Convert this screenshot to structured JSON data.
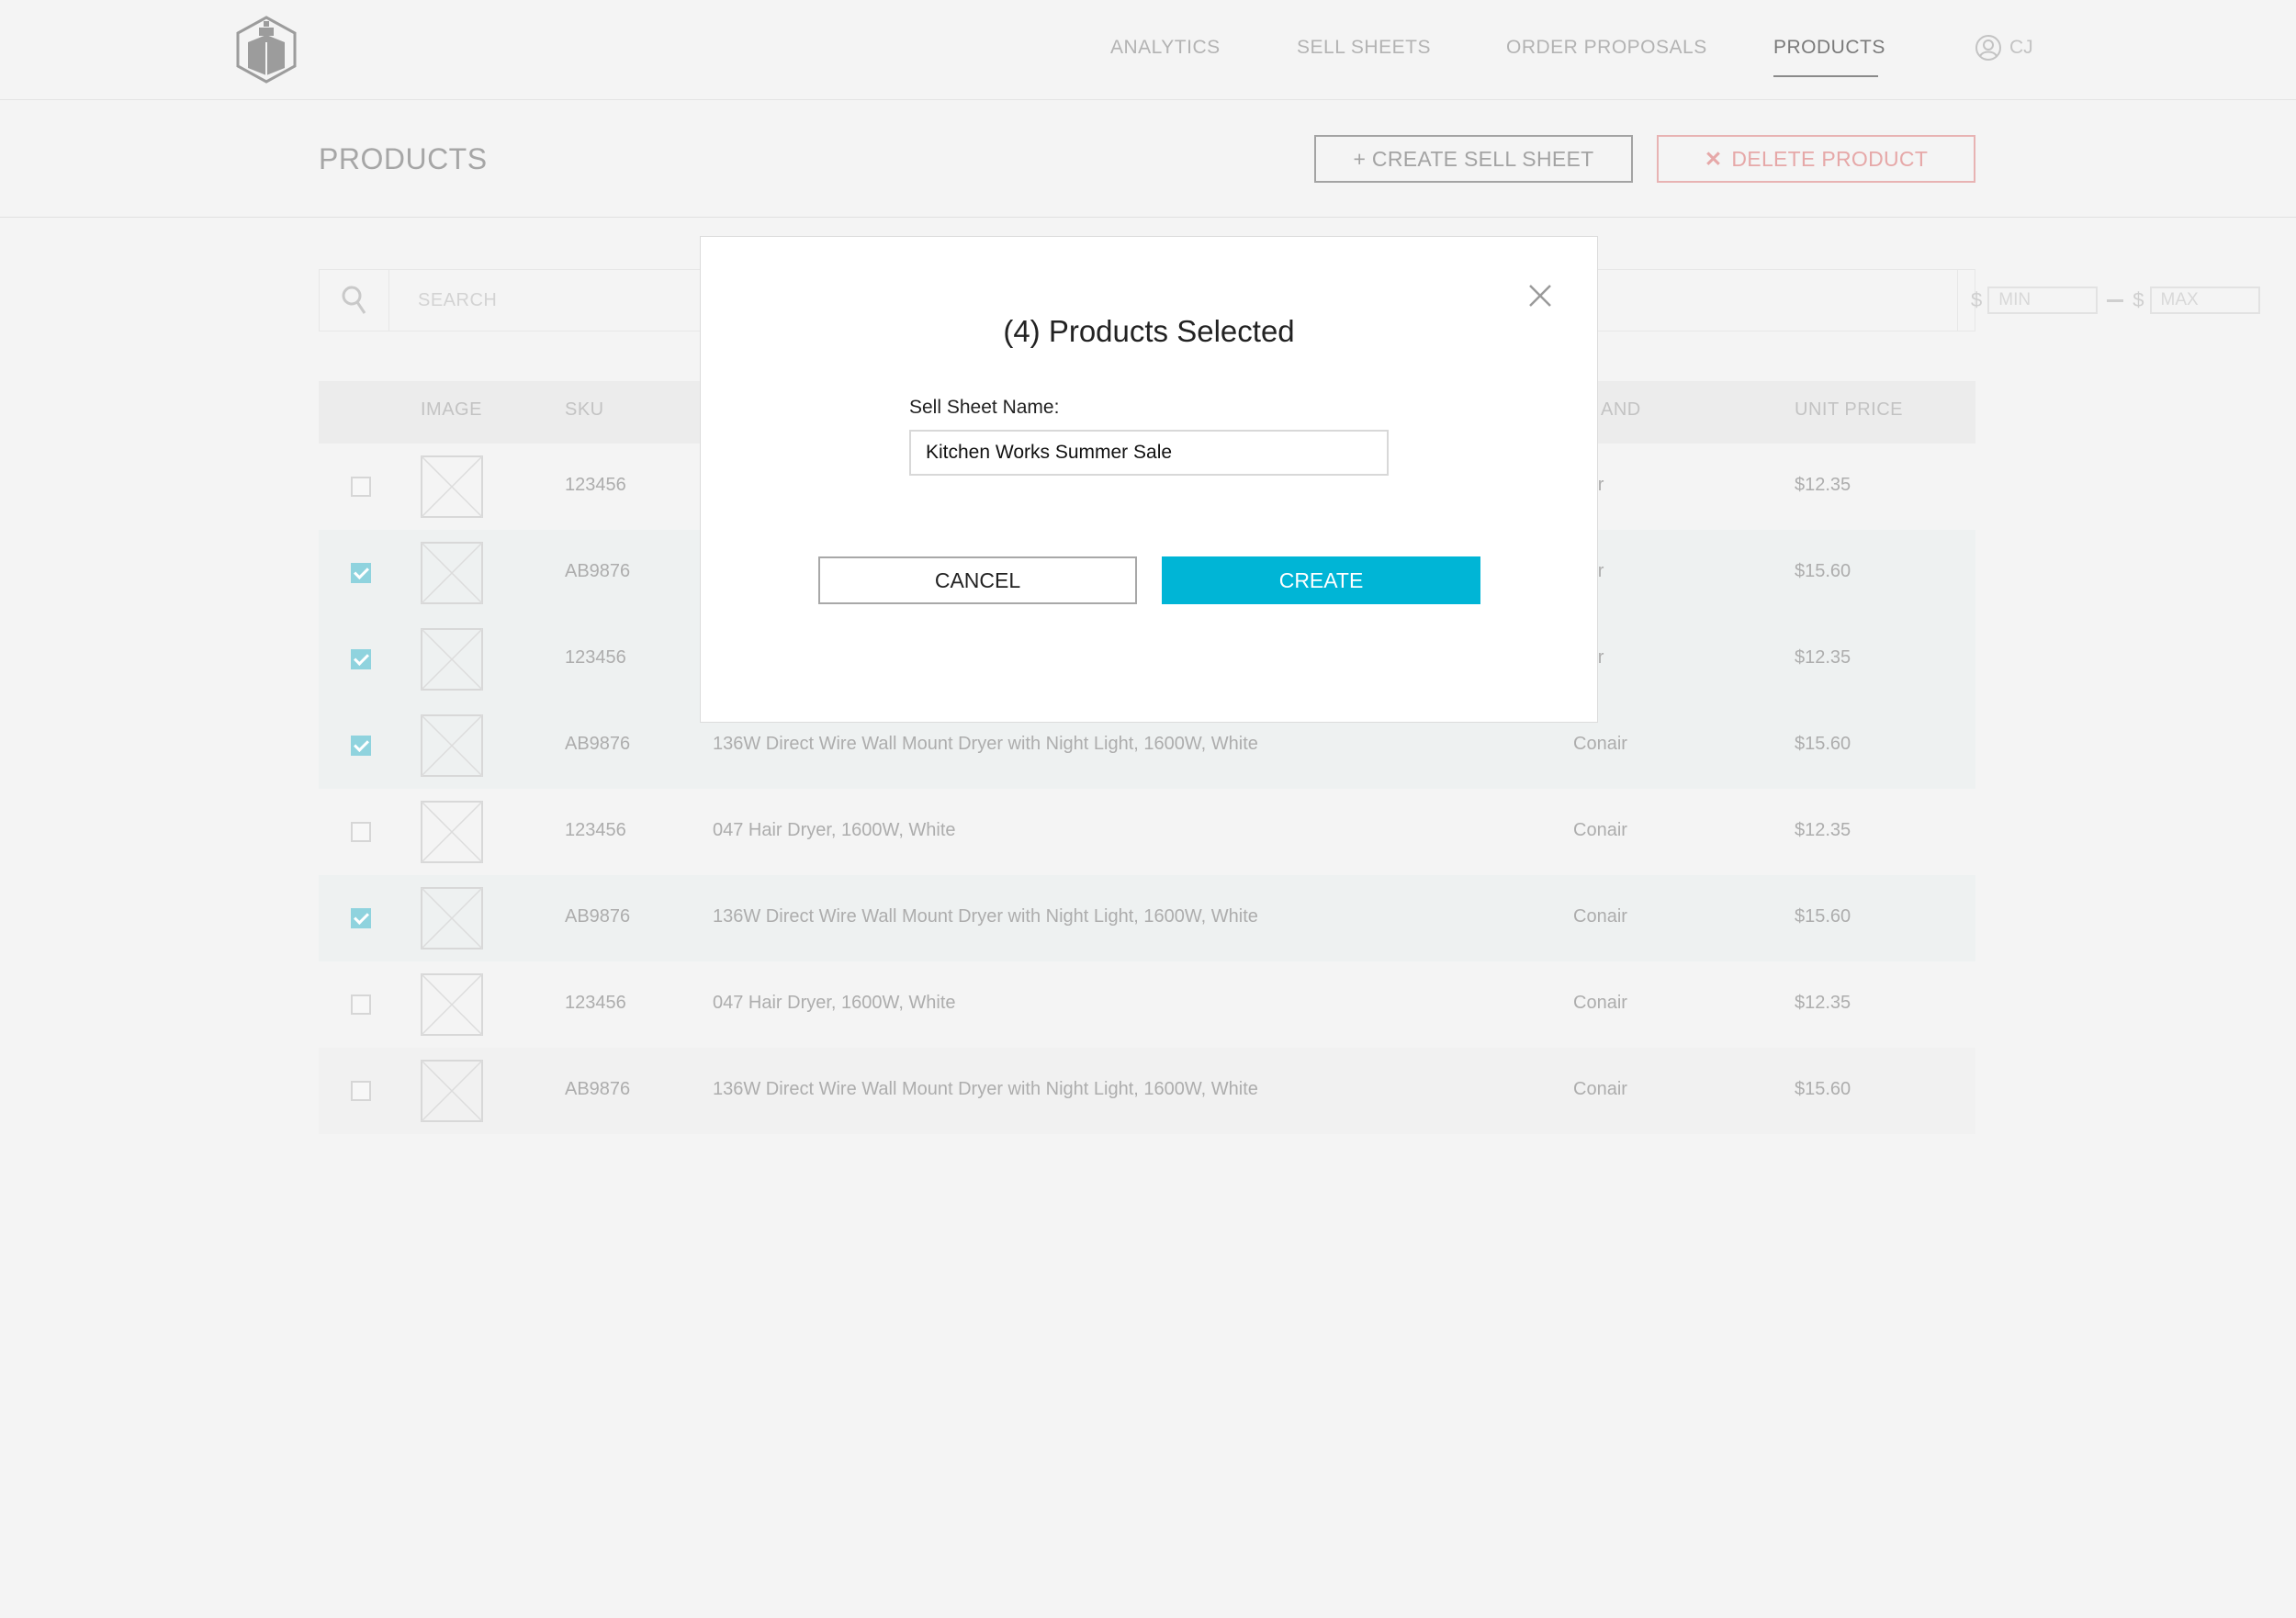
{
  "nav": {
    "items": [
      {
        "label": "ANALYTICS",
        "active": false
      },
      {
        "label": "SELL SHEETS",
        "active": false
      },
      {
        "label": "ORDER PROPOSALS",
        "active": false
      },
      {
        "label": "PRODUCTS",
        "active": true
      }
    ],
    "user_initials": "CJ"
  },
  "page": {
    "title": "PRODUCTS",
    "create_sell_sheet_label": "+ CREATE SELL SHEET",
    "delete_product_label": "DELETE PRODUCT"
  },
  "filters": {
    "search_placeholder": "SEARCH",
    "currency_symbol": "$",
    "min_placeholder": "MIN",
    "max_placeholder": "MAX"
  },
  "table": {
    "headers": {
      "image": "IMAGE",
      "sku": "SKU",
      "brand": "AND",
      "unit_price": "UNIT PRICE"
    },
    "rows": [
      {
        "checked": false,
        "sku": "123456",
        "description": "",
        "brand": "nair",
        "price": "$12.35"
      },
      {
        "checked": true,
        "sku": "AB9876",
        "description": "",
        "brand": "nair",
        "price": "$15.60"
      },
      {
        "checked": true,
        "sku": "123456",
        "description": "",
        "brand": "nair",
        "price": "$12.35"
      },
      {
        "checked": true,
        "sku": "AB9876",
        "description": "136W Direct Wire Wall Mount Dryer with Night Light, 1600W, White",
        "brand": "Conair",
        "price": "$15.60"
      },
      {
        "checked": false,
        "sku": "123456",
        "description": "047 Hair Dryer, 1600W, White",
        "brand": "Conair",
        "price": "$12.35"
      },
      {
        "checked": true,
        "sku": "AB9876",
        "description": "136W Direct Wire Wall Mount Dryer with Night Light, 1600W, White",
        "brand": "Conair",
        "price": "$15.60"
      },
      {
        "checked": false,
        "sku": "123456",
        "description": "047 Hair Dryer, 1600W, White",
        "brand": "Conair",
        "price": "$12.35"
      },
      {
        "checked": false,
        "sku": "AB9876",
        "description": "136W Direct Wire Wall Mount Dryer with Night Light, 1600W, White",
        "brand": "Conair",
        "price": "$15.60"
      }
    ]
  },
  "modal": {
    "title": "(4) Products Selected",
    "name_label": "Sell Sheet Name:",
    "name_value": "Kitchen Works Summer Sale",
    "cancel_label": "CANCEL",
    "create_label": "CREATE"
  },
  "colors": {
    "accent": "#00b5d6",
    "checkbox_checked": "#8fd3de",
    "delete": "#e6a8a8"
  }
}
